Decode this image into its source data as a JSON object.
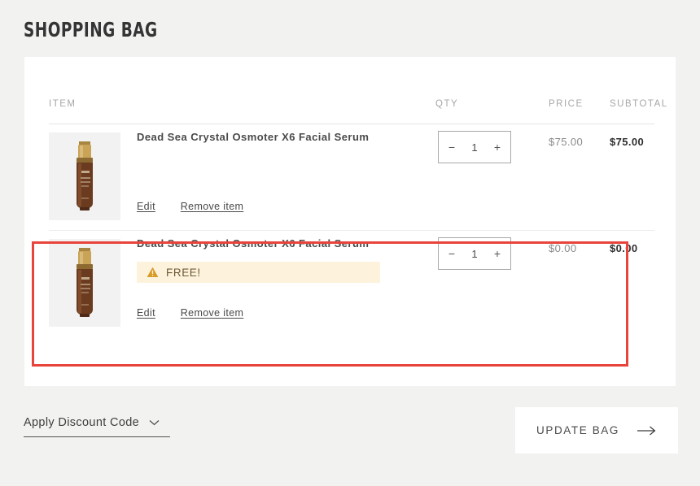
{
  "page": {
    "title": "SHOPPING BAG",
    "background_color": "#f2f2f1",
    "card_color": "#ffffff"
  },
  "table": {
    "headers": {
      "item": "ITEM",
      "qty": "QTY",
      "price": "PRICE",
      "subtotal": "SUBTOTAL"
    }
  },
  "rows": [
    {
      "title": "Dead Sea Crystal Osmoter X6 Facial Serum",
      "qty": "1",
      "qty_minus": "−",
      "qty_plus": "+",
      "price": "$75.00",
      "subtotal": "$75.00",
      "edit_label": "Edit",
      "remove_label": "Remove item",
      "badge": null
    },
    {
      "title": "Dead Sea Crystal Osmoter X6 Facial Serum",
      "qty": "1",
      "qty_minus": "−",
      "qty_plus": "+",
      "price": "$0.00",
      "subtotal": "$0.00",
      "edit_label": "Edit",
      "remove_label": "Remove item",
      "badge": {
        "text": "FREE!",
        "icon": "warning-triangle-icon",
        "background_color": "#fdf3dd",
        "icon_color": "#d79b2a",
        "text_color": "#6c5a33"
      }
    }
  ],
  "highlight": {
    "color": "#e8443c",
    "target_row_index": 1
  },
  "footer": {
    "discount_label": "Apply Discount Code",
    "discount_icon": "chevron-down-icon",
    "update_label": "UPDATE BAG",
    "update_icon": "arrow-right-icon"
  },
  "thumbnail": {
    "icon": "serum-bottle-image",
    "cap_color": "#c9a356",
    "body_color": "#6b3b20",
    "background_color": "#f2f2f2"
  }
}
